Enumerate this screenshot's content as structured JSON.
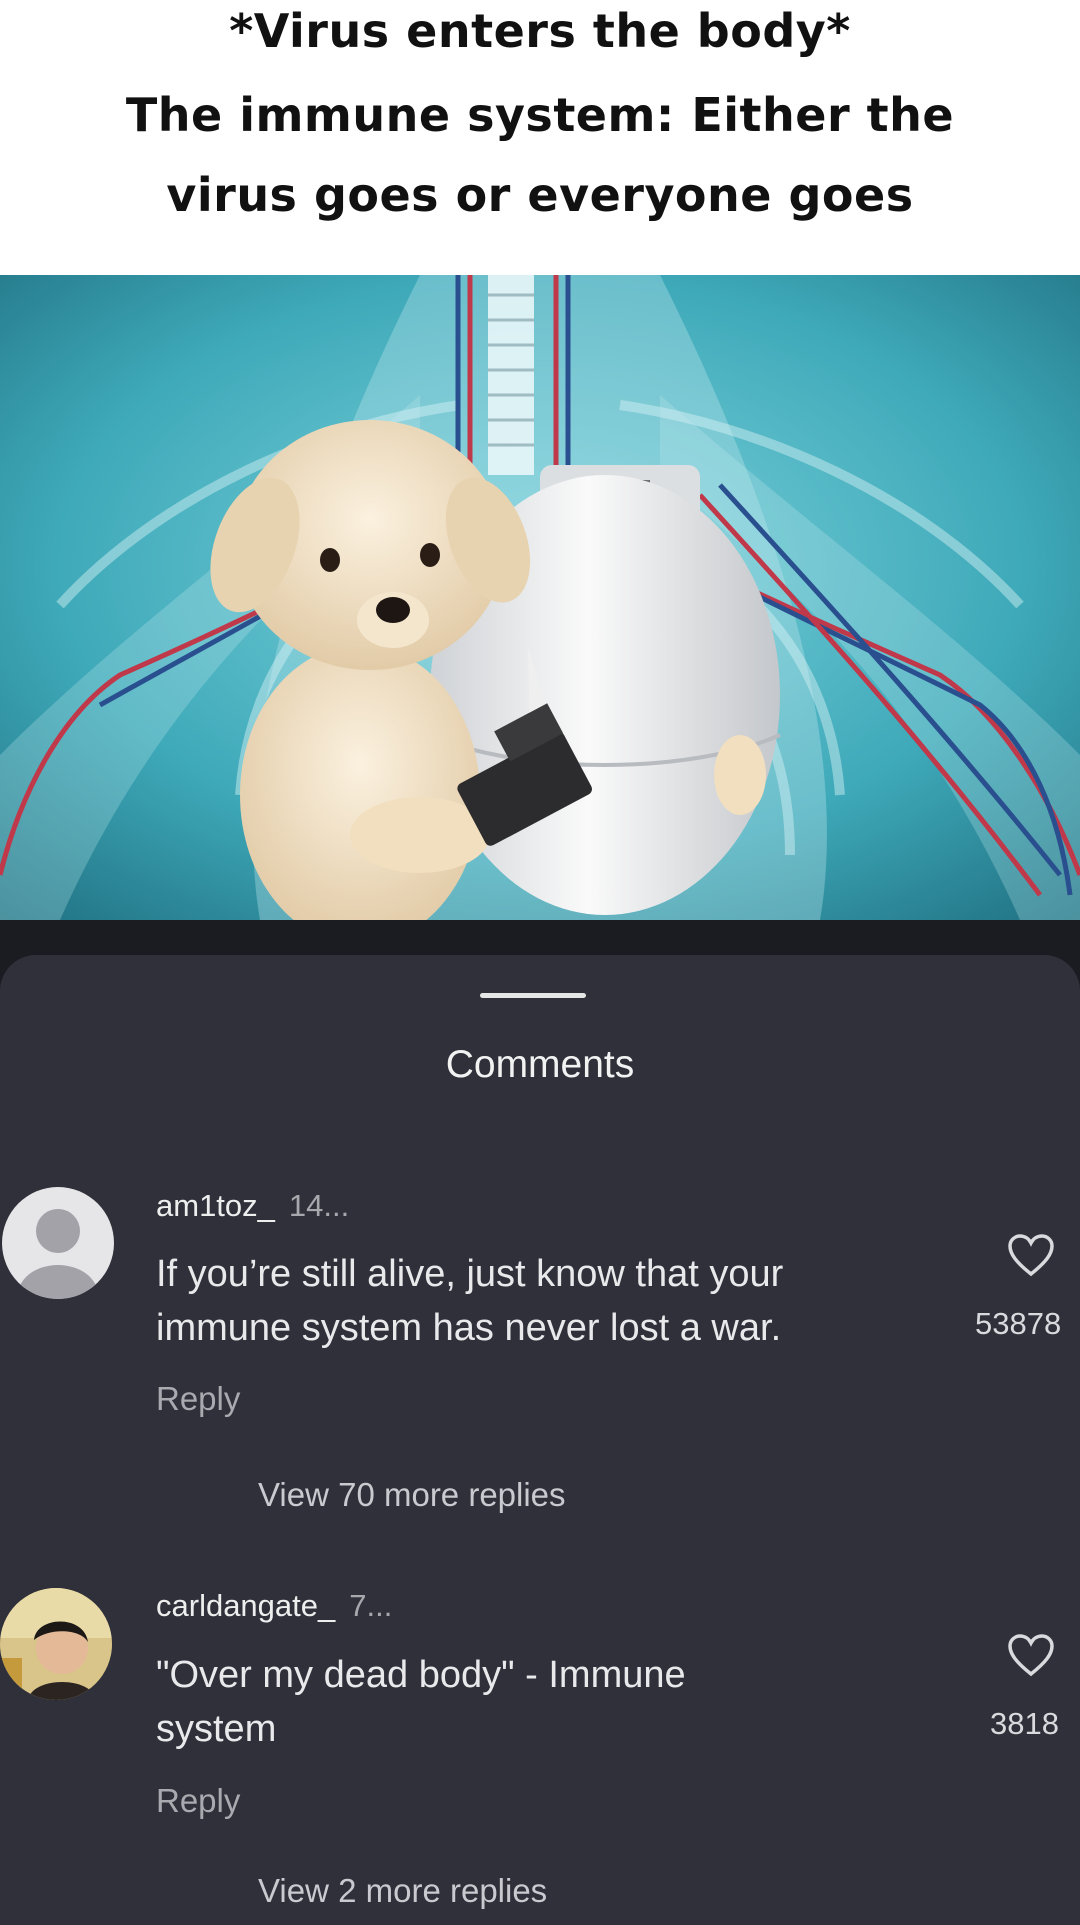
{
  "meme": {
    "caption_line1": "*Virus enters the body*",
    "caption_line2": "The immune system: Either the",
    "caption_line3": "virus goes or everyone goes"
  },
  "sheet": {
    "title": "Comments"
  },
  "comments": [
    {
      "username": "am1toz_",
      "time": "14...",
      "text_line1": "If you’re still alive, just know that your",
      "text_line2": "immune system has never lost a war.",
      "reply_label": "Reply",
      "like_count": "53878",
      "view_replies": "View 70 more replies"
    },
    {
      "username": "carldangate_",
      "time": "7...",
      "text_line1": "\"Over my dead body\" - Immune",
      "text_line2": "system",
      "reply_label": "Reply",
      "like_count": "3818",
      "view_replies": "View 2 more replies"
    }
  ],
  "colors": {
    "background": "#2f3039",
    "text": "#e9e9ec",
    "muted": "#a9a9b0",
    "image_bg": "#3aa7b8"
  }
}
